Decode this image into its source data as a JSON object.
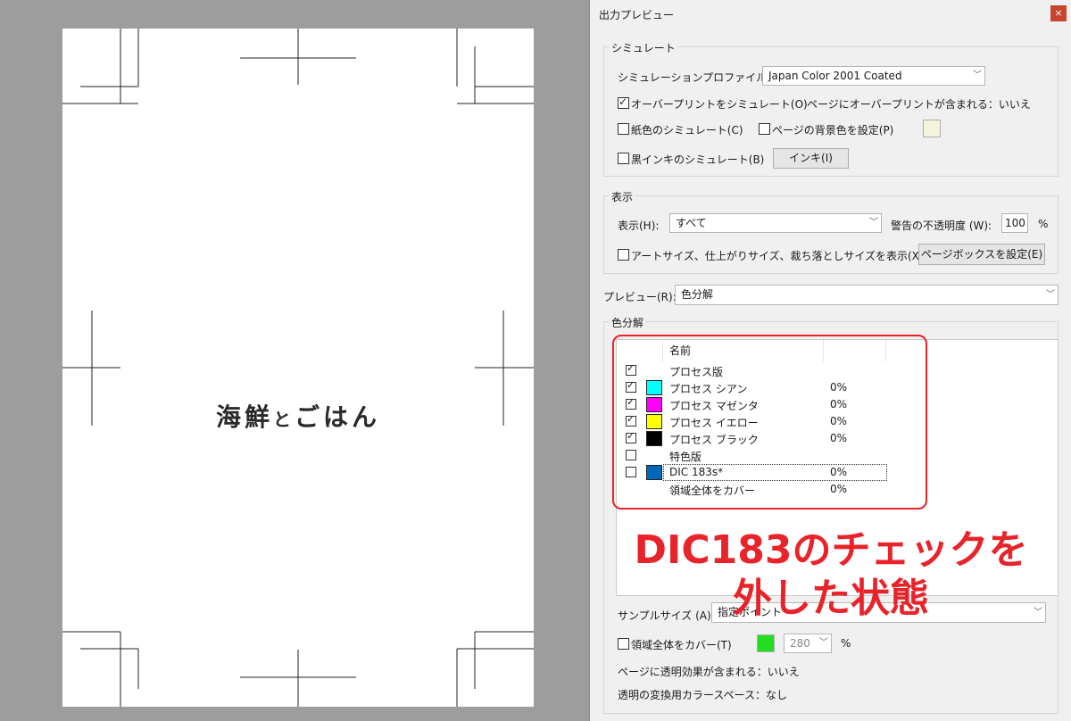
{
  "document": {
    "title_part1": "海鮮",
    "title_part2": "と",
    "title_part3": "ごはん"
  },
  "dialog": {
    "title": "出力プレビュー",
    "close": "×",
    "simulate": {
      "group_label": "シミュレート",
      "profile_label": "シミュレーションプロファイル(S):",
      "profile_value": "Japan Color 2001 Coated",
      "overprint_label": "オーバープリントをシミュレート(O)",
      "overprint_checked": true,
      "overprint_info": "ページにオーバープリントが含まれる：いいえ",
      "paper_label": "紙色のシミュレート(C)",
      "bg_label": "ページの背景色を設定(P)",
      "black_ink_label": "黒インキのシミュレート(B)",
      "ink_button": "インキ(I)"
    },
    "display": {
      "group_label": "表示",
      "show_label": "表示(H):",
      "show_value": "すべて",
      "opacity_label": "警告の不透明度 (W):",
      "opacity_value": "100",
      "opacity_unit": "%",
      "boxes_label": "アートサイズ、仕上がりサイズ、裁ち落としサイズを表示(X)",
      "pagebox_button": "ページボックスを設定(E)"
    },
    "preview": {
      "label": "プレビュー(R):",
      "value": "色分解"
    },
    "separations": {
      "group_label": "色分解",
      "header_name": "名前",
      "rows": [
        {
          "checked": true,
          "swatch": "",
          "name": "プロセス版",
          "pct": ""
        },
        {
          "checked": true,
          "swatch": "#00ffff",
          "name": "プロセス シアン",
          "pct": "0%"
        },
        {
          "checked": true,
          "swatch": "#ff00ff",
          "name": "プロセス マゼンタ",
          "pct": "0%"
        },
        {
          "checked": true,
          "swatch": "#ffff00",
          "name": "プロセス イエロー",
          "pct": "0%"
        },
        {
          "checked": true,
          "swatch": "#000000",
          "name": "プロセス ブラック",
          "pct": "0%"
        },
        {
          "checked": false,
          "swatch": "",
          "name": "特色版",
          "pct": ""
        },
        {
          "checked": false,
          "swatch": "#0068b7",
          "name": "DIC 183s*",
          "pct": "0%"
        },
        {
          "checked": null,
          "swatch": "",
          "name": "領域全体をカバー",
          "pct": "0%"
        }
      ]
    },
    "sample": {
      "label": "サンプルサイズ (A):",
      "value": "指定ポイント"
    },
    "coverage": {
      "label": "領域全体をカバー(T)",
      "color": "#22dd22",
      "value": "280",
      "unit": "%"
    },
    "transparency_info": "ページに透明効果が含まれる：いいえ",
    "blend_space_info": "透明の変換用カラースペース：なし"
  },
  "annotation": {
    "line1": "DIC183のチェックを",
    "line2": "外した状態",
    "color": "#e8232a"
  }
}
